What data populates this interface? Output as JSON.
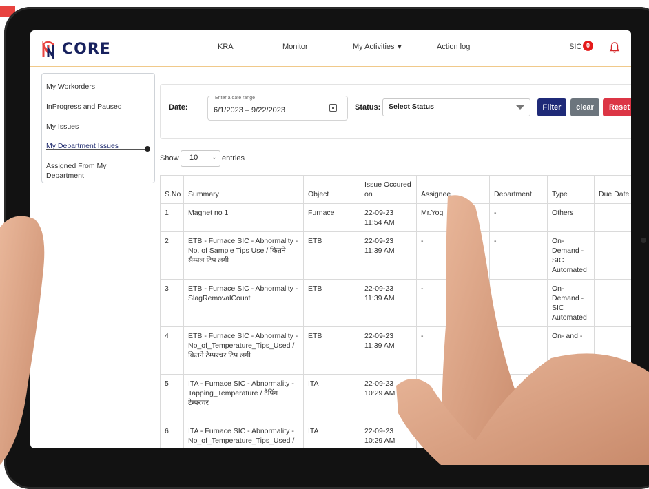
{
  "brand": {
    "name": "CORE"
  },
  "nav": {
    "items": [
      {
        "label": "KRA"
      },
      {
        "label": "Monitor"
      },
      {
        "label": "My Activities"
      },
      {
        "label": "Action log"
      }
    ]
  },
  "header": {
    "sic_label": "SIC",
    "notification_count": "0"
  },
  "sidebar": {
    "items": [
      {
        "label": "My Workorders"
      },
      {
        "label": "InProgress and Paused"
      },
      {
        "label": "My Issues"
      },
      {
        "label": "My Department Issues"
      },
      {
        "label": "Assigned From My Department"
      }
    ]
  },
  "filter": {
    "date_label": "Date:",
    "date_caption": "Enter a date range",
    "date_value": "6/1/2023 – 9/22/2023",
    "status_label": "Status:",
    "status_value": "Select Status",
    "filter_button": "Filter",
    "clear_button": "clear",
    "reset_button": "Reset"
  },
  "entries": {
    "show_label": "Show",
    "value": "10",
    "suffix": "entries"
  },
  "table": {
    "headers": [
      "S.No",
      "Summary",
      "Object",
      "Issue Occured on",
      "Assignee",
      "Department",
      "Type",
      "Due Date"
    ],
    "rows": [
      [
        "1",
        "Magnet no 1",
        "Furnace",
        "22-09-23 11:54 AM",
        "Mr.Yog",
        "-",
        "Others",
        ""
      ],
      [
        "2",
        "ETB - Furnace SIC - Abnormality - No. of Sample Tips Use / कितने सैम्पल टिप लगी",
        "ETB",
        "22-09-23 11:39 AM",
        "-",
        "-",
        "On-Demand - SIC Automated",
        ""
      ],
      [
        "3",
        "ETB - Furnace SIC - Abnormality - SlagRemovalCount",
        "ETB",
        "22-09-23 11:39 AM",
        "-",
        "",
        "On-Demand - SIC Automated",
        ""
      ],
      [
        "4",
        "ETB - Furnace SIC - Abnormality - No_of_Temperature_Tips_Used / कितने टेम्परचर टिप लगी",
        "ETB",
        "22-09-23 11:39 AM",
        "-",
        "",
        "On- and -",
        ""
      ],
      [
        "5",
        "ITA - Furnace SIC - Abnormality - Tapping_Temperature / टैपिंग टेम्परचर",
        "ITA",
        "22-09-23 10:29 AM",
        "",
        "",
        "",
        ""
      ],
      [
        "6",
        "ITA - Furnace SIC - Abnormality - No_of_Temperature_Tips_Used /",
        "ITA",
        "22-09-23 10:29 AM",
        "",
        "",
        "",
        ""
      ]
    ]
  },
  "colors": {
    "brand": "#17215e",
    "filter_button": "#1f2a78",
    "clear_button": "#6c757d",
    "reset_button": "#dc3545",
    "badge": "#e51a1a",
    "accent": "#e8433f"
  },
  "icons": [
    "logo-mark-icon",
    "calendar-icon",
    "chevron-down-icon",
    "bell-icon",
    "caret-down-icon"
  ]
}
